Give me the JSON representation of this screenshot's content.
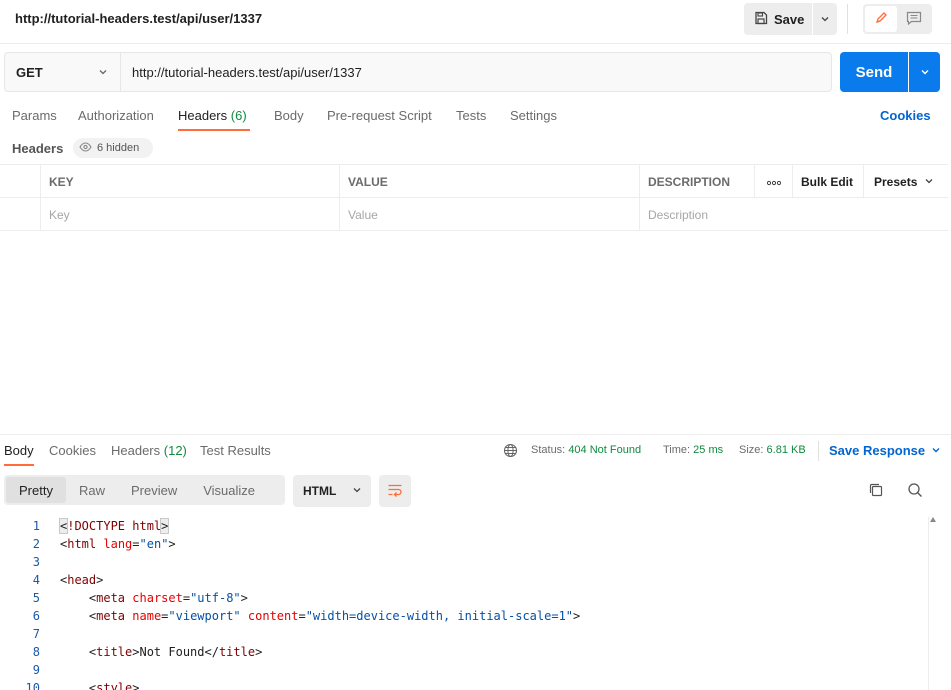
{
  "top": {
    "title": "http://tutorial-headers.test/api/user/1337",
    "save_label": "Save"
  },
  "request": {
    "method": "GET",
    "url": "http://tutorial-headers.test/api/user/1337",
    "send_label": "Send"
  },
  "tabs": {
    "params": "Params",
    "authorization": "Authorization",
    "headers": "Headers",
    "headers_count": "(6)",
    "body": "Body",
    "pre_request": "Pre-request Script",
    "tests": "Tests",
    "settings": "Settings",
    "cookies": "Cookies"
  },
  "headers_section": {
    "title": "Headers",
    "hidden_label": "6 hidden",
    "columns": {
      "key": "KEY",
      "value": "VALUE",
      "description": "DESCRIPTION",
      "bulk_edit": "Bulk Edit",
      "presets": "Presets"
    },
    "placeholder": {
      "key": "Key",
      "value": "Value",
      "description": "Description"
    }
  },
  "response": {
    "tabs": {
      "body": "Body",
      "cookies": "Cookies",
      "headers": "Headers",
      "headers_count": "(12)",
      "test_results": "Test Results"
    },
    "status_label": "Status:",
    "status_value": "404 Not Found",
    "time_label": "Time:",
    "time_value": "25 ms",
    "size_label": "Size:",
    "size_value": "6.81 KB",
    "save_response": "Save Response",
    "views": {
      "pretty": "Pretty",
      "raw": "Raw",
      "preview": "Preview",
      "visualize": "Visualize"
    },
    "language": "HTML",
    "code_lines": [
      {
        "n": "1",
        "text": "<!DOCTYPE html>"
      },
      {
        "n": "2",
        "text": "<html lang=\"en\">"
      },
      {
        "n": "3",
        "text": ""
      },
      {
        "n": "4",
        "text": "<head>"
      },
      {
        "n": "5",
        "text": "    <meta charset=\"utf-8\">"
      },
      {
        "n": "6",
        "text": "    <meta name=\"viewport\" content=\"width=device-width, initial-scale=1\">"
      },
      {
        "n": "7",
        "text": ""
      },
      {
        "n": "8",
        "text": "    <title>Not Found</title>"
      },
      {
        "n": "9",
        "text": ""
      },
      {
        "n": "10",
        "text": "    <style>"
      }
    ]
  },
  "colors": {
    "accent": "#ff6c37",
    "send": "#097bed",
    "link": "#0265d2",
    "success_text": "#0f8a3e"
  }
}
